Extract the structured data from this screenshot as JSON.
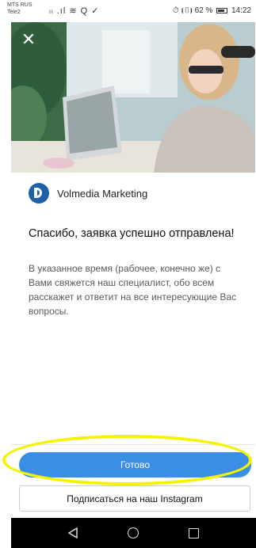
{
  "status_bar": {
    "carrier_line1": "MTS RUS",
    "carrier_line2": "Tele2",
    "left_icons": "ₗₗ .ıl ≋ Q ✓",
    "right_text_pre": "⏱ ⦗▯⦘ 62 %",
    "time": "14:22"
  },
  "hero": {
    "image_icon": "woman-laptop-photo",
    "close_icon": "close-icon"
  },
  "brand": {
    "name": "Volmedia Marketing"
  },
  "message": {
    "title": "Спасибо, заявка успешно отправлена!",
    "body": "В указанное время (рабочее, конечно же) с Вами свяжется наш специалист, обо всем расскажет и ответит на все интересующие Вас вопросы."
  },
  "actions": {
    "done_label": "Готово",
    "instagram_label": "Подписаться на наш Instagram"
  },
  "colors": {
    "accent": "#3b8ee6",
    "highlight": "#f4f400",
    "logo": "#1f5fa8"
  }
}
